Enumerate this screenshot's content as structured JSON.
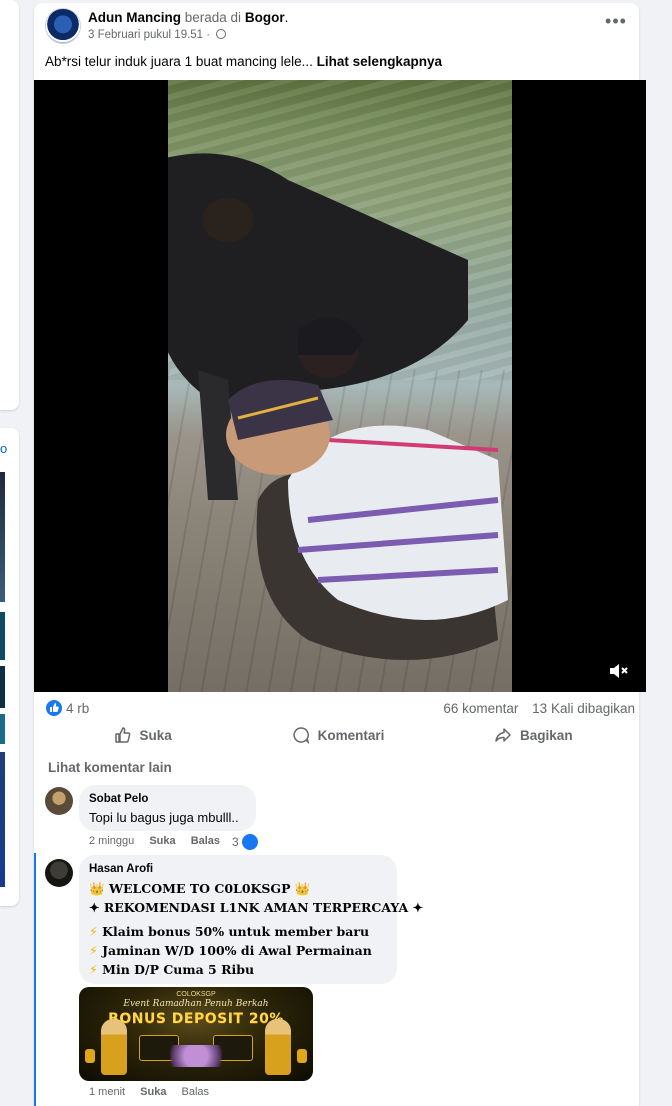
{
  "sidebar": {
    "link_char": "o"
  },
  "post": {
    "author": "Adun Mancing",
    "location_prefix": "berada di",
    "location": "Bogor",
    "location_suffix": ".",
    "timestamp": "3 Februari pukul 19.51",
    "timestamp_sep": "·",
    "more_icon": "more-horizontal-icon",
    "caption": "Ab*rsi telur induk juara 1 buat mancing lele...",
    "see_more": "Lihat selengkapnya",
    "video_muted": true
  },
  "stats": {
    "reactions": "4 rb",
    "comments": "66 komentar",
    "shares": "13 Kali dibagikan"
  },
  "actions": {
    "like": "Suka",
    "comment": "Komentari",
    "share": "Bagikan"
  },
  "more_comments": "Lihat komentar lain",
  "comments": [
    {
      "author": "Sobat Pelo",
      "text": "Topi lu bagus juga mbulll..",
      "time": "2 minggu",
      "like": "Suka",
      "reply": "Balas",
      "reaction_count": "3"
    },
    {
      "author": "Hasan Arofi",
      "lines": [
        {
          "pre": "👑",
          "text": "WELCOME TO C0L0KSGP",
          "post": "👑"
        },
        {
          "pre": "✦",
          "text": "REKOMENDASI L1NK AMAN TERPERCAYA",
          "post": "✦"
        },
        {
          "pre": "⚡",
          "text": "Klaim bonus 50% untuk member baru",
          "post": ""
        },
        {
          "pre": "⚡",
          "text": "Jaminan W/D 100% di Awal Permainan",
          "post": ""
        },
        {
          "pre": "⚡",
          "text": "Min D/P Cuma 5 Ribu",
          "post": ""
        }
      ],
      "banner": {
        "brand": "COLOKSGP",
        "event": "Event Ramadhan Penuh Berkah",
        "title": "BONUS DEPOSIT 20%"
      },
      "time": "1 menit",
      "like": "Suka",
      "reply": "Balas"
    }
  ],
  "colors": {
    "accent": "#1877f2",
    "muted": "#65676b",
    "bubble": "#f0f2f5"
  }
}
